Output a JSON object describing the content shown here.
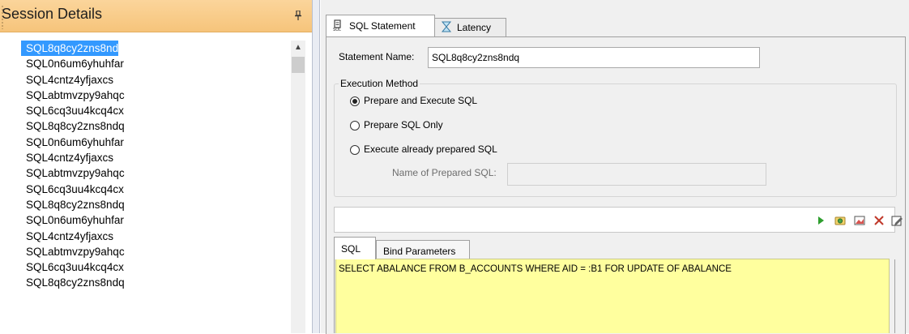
{
  "left_panel": {
    "title": "Session Details",
    "sessions": [
      "SQL8q8cy2zns8ndq",
      "SQL0n6um6yhuhfar",
      "SQL4cntz4yfjaxcs",
      "SQLabtmvzpy9ahqc",
      "SQL6cq3uu4kcq4cx",
      "SQL8q8cy2zns8ndq",
      "SQL0n6um6yhuhfar",
      "SQL4cntz4yfjaxcs",
      "SQLabtmvzpy9ahqc",
      "SQL6cq3uu4kcq4cx",
      "SQL8q8cy2zns8ndq",
      "SQL0n6um6yhuhfar",
      "SQL4cntz4yfjaxcs",
      "SQLabtmvzpy9ahqc",
      "SQL6cq3uu4kcq4cx",
      "SQL8q8cy2zns8ndq"
    ],
    "selected_index": 0
  },
  "tabs": {
    "sql_statement": "SQL Statement",
    "latency": "Latency"
  },
  "form": {
    "statement_name_label": "Statement Name:",
    "statement_name_value": "SQL8q8cy2zns8ndq",
    "execution_method_label": "Execution Method",
    "options": {
      "prepare_execute": "Prepare and Execute SQL",
      "prepare_only": "Prepare SQL Only",
      "execute_prepared": "Execute already prepared SQL"
    },
    "selected_option": "prepare_execute",
    "prepared_sql_label": "Name of Prepared SQL:",
    "prepared_sql_value": ""
  },
  "editor": {
    "tab_sql": "SQL",
    "tab_bind": "Bind Parameters",
    "sql_text": "SELECT ABALANCE FROM B_ACCOUNTS WHERE AID = :B1 FOR UPDATE OF ABALANCE"
  },
  "toolbar_icons": [
    "run-icon",
    "open-icon",
    "image-icon",
    "delete-icon",
    "edit-icon"
  ],
  "colors": {
    "header_orange": "#f6c47b",
    "selection_blue": "#3399ff",
    "editor_yellow": "#ffff9e",
    "run_green": "#2e9e2e",
    "delete_red": "#c0392b"
  }
}
